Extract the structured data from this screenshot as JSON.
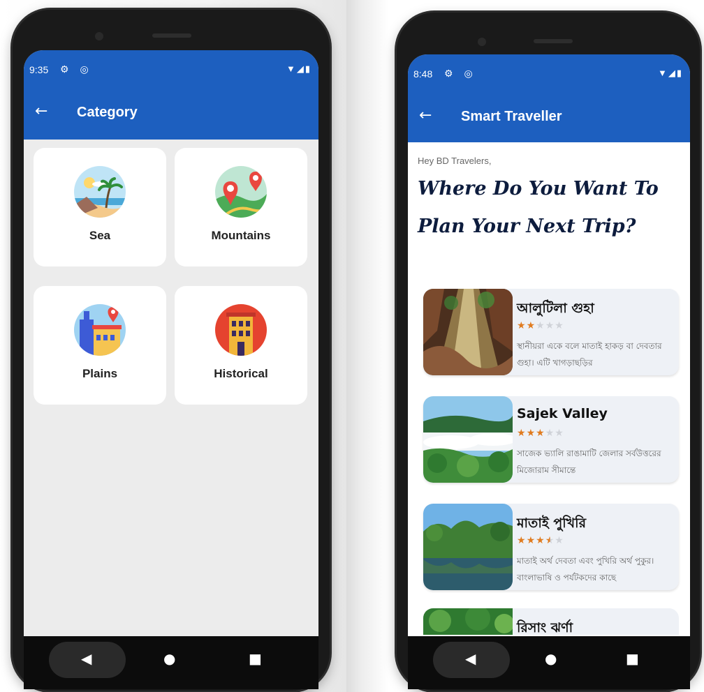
{
  "left_phone": {
    "status": {
      "time": "9:35",
      "left_icons": "⚙ ◎",
      "right_icons": "▼◢▮"
    },
    "app_bar": {
      "back_icon": "←",
      "title": "Category"
    },
    "categories": [
      {
        "label": "Sea",
        "icon": "beach-icon"
      },
      {
        "label": "Mountains",
        "icon": "map-pin-icon"
      },
      {
        "label": "Plains",
        "icon": "city-icon"
      },
      {
        "label": "Historical",
        "icon": "building-icon"
      }
    ],
    "nav": {
      "back": "◀",
      "home": "●",
      "recent": "■"
    }
  },
  "right_phone": {
    "status": {
      "time": "8:48",
      "left_icons": "⚙ ◎",
      "right_icons": "▼◢▮"
    },
    "app_bar": {
      "back_icon": "←",
      "title": "Smart Traveller"
    },
    "greeting": "Hey BD Travelers,",
    "headline": "Where Do You Want To Plan Your Next Trip?",
    "places": [
      {
        "name": "আলুটিলা গুহা",
        "rating": 2,
        "desc": "স্থানীয়রা একে বলে মাতাই হাকড় বা দেবতার গুহা। এটি খাগড়াছড়ির"
      },
      {
        "name": "Sajek Valley",
        "rating": 3,
        "desc": "সাজেক ভ্যালি রাঙামাটি জেলার সর্বউত্তরের মিজোরাম সীমান্তে"
      },
      {
        "name": "মাতাই পুখিরি",
        "rating": 3.5,
        "desc": "মাতাই অর্থ দেবতা এবং পুখিরি অর্থ পুকুর। বাংলাভাষি ও পর্যটকদের কাছে"
      },
      {
        "name": "রিসাং ঝর্ণা"
      }
    ],
    "nav": {
      "back": "◀",
      "home": "●",
      "recent": "■"
    }
  }
}
